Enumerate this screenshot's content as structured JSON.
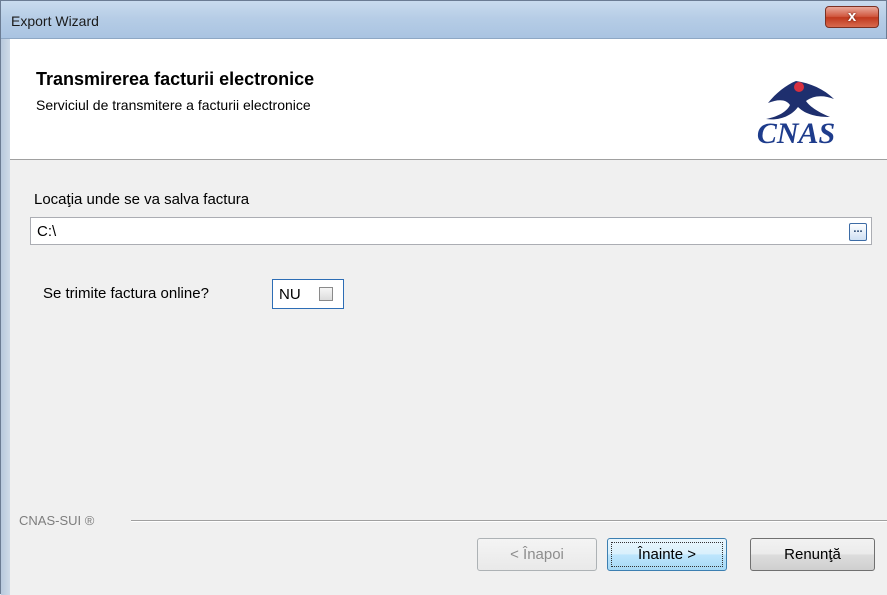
{
  "window": {
    "title": "Export Wizard",
    "close_glyph": "x"
  },
  "header": {
    "title": "Transmirerea facturii electronice",
    "subtitle": "Serviciul de transmitere a facturii electronice",
    "logo_text": "CNAS",
    "logo_colors": {
      "text": "#1e3c8c",
      "bird": "#1e2f6e",
      "accent": "#d8303f"
    }
  },
  "location": {
    "label": "Locaţia unde se va salva factura",
    "value": "C:\\",
    "browse_label": "..."
  },
  "online": {
    "label": "Se trimite factura online?",
    "value_text": "NU",
    "checked": false
  },
  "footer": {
    "brand": "CNAS-SUI ®",
    "back_label": "< Înapoi",
    "next_label": "Înainte >",
    "cancel_label": "Renunţă"
  }
}
